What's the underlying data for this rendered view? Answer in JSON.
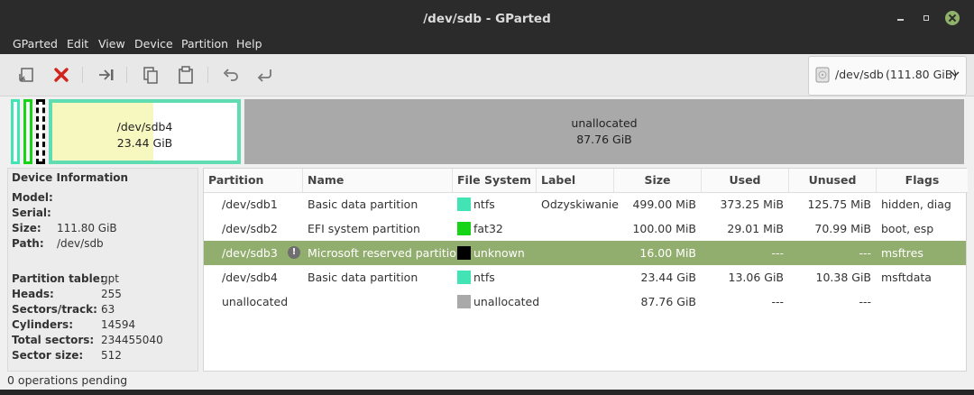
{
  "window": {
    "title": "/dev/sdb - GParted"
  },
  "menu": [
    "GParted",
    "Edit",
    "View",
    "Device",
    "Partition",
    "Help"
  ],
  "toolbar": {
    "buttons": [
      "new-partition-icon",
      "delete-icon",
      "resize-move-icon",
      "copy-icon",
      "paste-icon",
      "undo-icon",
      "apply-icon"
    ]
  },
  "device_selector": {
    "path": "/dev/sdb",
    "size": "(111.80 GiB)"
  },
  "diskmap": {
    "sdb4": {
      "name": "/dev/sdb4",
      "size": "23.44 GiB"
    },
    "unallocated": {
      "name": "unallocated",
      "size": "87.76 GiB"
    }
  },
  "device_info": {
    "heading": "Device Information",
    "labels": {
      "model": "Model:",
      "serial": "Serial:",
      "size": "Size:",
      "path": "Path:",
      "partition_table": "Partition table:",
      "heads": "Heads:",
      "sectors_track": "Sectors/track:",
      "cylinders": "Cylinders:",
      "total_sectors": "Total sectors:",
      "sector_size": "Sector size:"
    },
    "values": {
      "size": "111.80 GiB",
      "path": "/dev/sdb",
      "partition_table": "gpt",
      "heads": "255",
      "sectors_track": "63",
      "cylinders": "14594",
      "total_sectors": "234455040",
      "sector_size": "512"
    }
  },
  "table": {
    "columns": [
      "Partition",
      "Name",
      "File System",
      "Label",
      "Size",
      "Used",
      "Unused",
      "Flags"
    ],
    "rows": [
      {
        "partition": "/dev/sdb1",
        "name": "Basic data partition",
        "fs": "ntfs",
        "fs_color": "#42e3b4",
        "label": "Odzyskiwanie",
        "size": "499.00 MiB",
        "used": "373.25 MiB",
        "unused": "125.75 MiB",
        "flags": "hidden, diag"
      },
      {
        "partition": "/dev/sdb2",
        "name": "EFI system partition",
        "fs": "fat32",
        "fs_color": "#18d418",
        "label": "",
        "size": "100.00 MiB",
        "used": "29.01 MiB",
        "unused": "70.99 MiB",
        "flags": "boot, esp"
      },
      {
        "partition": "/dev/sdb3",
        "name": "Microsoft reserved partition",
        "fs": "unknown",
        "fs_color": "#000000",
        "label": "",
        "size": "16.00 MiB",
        "used": "---",
        "unused": "---",
        "flags": "msftres"
      },
      {
        "partition": "/dev/sdb4",
        "name": "Basic data partition",
        "fs": "ntfs",
        "fs_color": "#42e3b4",
        "label": "",
        "size": "23.44 GiB",
        "used": "13.06 GiB",
        "unused": "10.38 GiB",
        "flags": "msftdata"
      },
      {
        "partition": "unallocated",
        "name": "",
        "fs": "unallocated",
        "fs_color": "#a9a9a9",
        "label": "",
        "size": "87.76 GiB",
        "used": "---",
        "unused": "---",
        "flags": ""
      }
    ]
  },
  "status": {
    "text": "0 operations pending"
  },
  "colors": {
    "accent": "#92ae6e",
    "ntfs": "#42e3b4",
    "fat32": "#18d418",
    "unallocated": "#a9a9a9",
    "used": "#f7f7c0"
  }
}
